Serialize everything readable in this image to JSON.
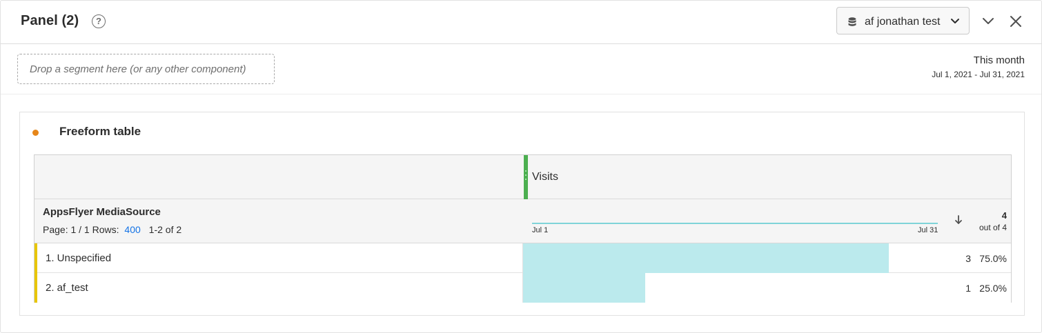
{
  "panel": {
    "title": "Panel (2)",
    "help_icon": "?",
    "report_suite": "af jonathan test",
    "icons": [
      "database-icon",
      "chevron-down-icon",
      "collapse-icon",
      "close-icon"
    ]
  },
  "segment_drop": {
    "placeholder": "Drop a segment here (or any other component)"
  },
  "date": {
    "title": "This month",
    "range": "Jul 1, 2021 - Jul 31, 2021"
  },
  "visualization": {
    "title": "Freeform table",
    "dot_color": "#e68619",
    "metric": "Visits",
    "metric_color": "#4caf50",
    "dimension": "AppsFlyer MediaSource",
    "paging": {
      "page_label": "Page: 1 / 1",
      "rows_label": "Rows:",
      "rows_value": "400",
      "range": "1-2 of 2"
    },
    "sparkline": {
      "start_label": "Jul 1",
      "end_label": "Jul 31"
    },
    "total": {
      "value": "4",
      "out_of": "out of 4"
    },
    "rows": [
      {
        "label": "1. Unspecified",
        "value": "3",
        "percent": "75.0%",
        "share": 0.75
      },
      {
        "label": "2. af_test",
        "value": "1",
        "percent": "25.0%",
        "share": 0.25
      }
    ]
  }
}
